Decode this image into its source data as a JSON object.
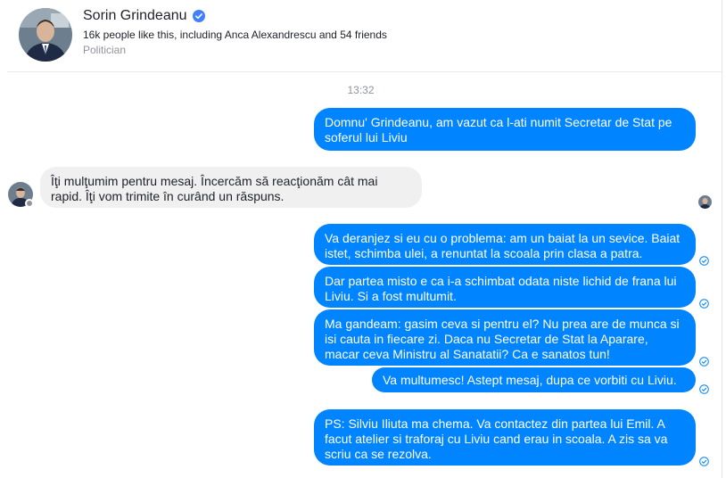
{
  "page": {
    "name": "Sorin Grindeanu",
    "likes": "16k people like this, including Anca Alexandrescu and 54 friends",
    "category": "Politician",
    "verified_icon": "verified-badge-icon",
    "accent_color": "#0084ff"
  },
  "conversation": {
    "timestamp": "13:32",
    "messages": [
      {
        "direction": "outgoing",
        "text": "Domnu' Grindeanu, am vazut ca l-ati numit Secretar de Stat pe soferul lui Liviu"
      },
      {
        "direction": "incoming",
        "text": "Îţi mulţumim pentru mesaj. Încercăm să reacţionăm cât mai rapid. Îţi vom trimite în curând un răspuns."
      },
      {
        "direction": "outgoing",
        "text": "Va deranjez si eu cu o problema: am un baiat la  un sevice. Baiat istet, schimba ulei, a renuntat la scoala prin clasa a patra."
      },
      {
        "direction": "outgoing",
        "text": "Dar partea misto e ca i-a schimbat odata niste  lichid de frana lui Liviu. Si a fost multumit."
      },
      {
        "direction": "outgoing",
        "text": "Ma gandeam: gasim ceva si pentru el? Nu prea are de munca si isi cauta in fiecare zi. Daca nu Secretar de Stat la Aparare, macar ceva Ministru al Sanatatii? Ca e sanatos tun!"
      },
      {
        "direction": "outgoing",
        "text": "Va multumesc! Astept mesaj, dupa ce vorbiti cu Liviu."
      },
      {
        "direction": "outgoing",
        "text": "PS: Silviu Iliuta ma chema. Va contactez din partea lui Emil. A facut atelier si traforaj cu Liviu cand erau in scoala. A zis sa va scriu ca se rezolva."
      }
    ]
  }
}
